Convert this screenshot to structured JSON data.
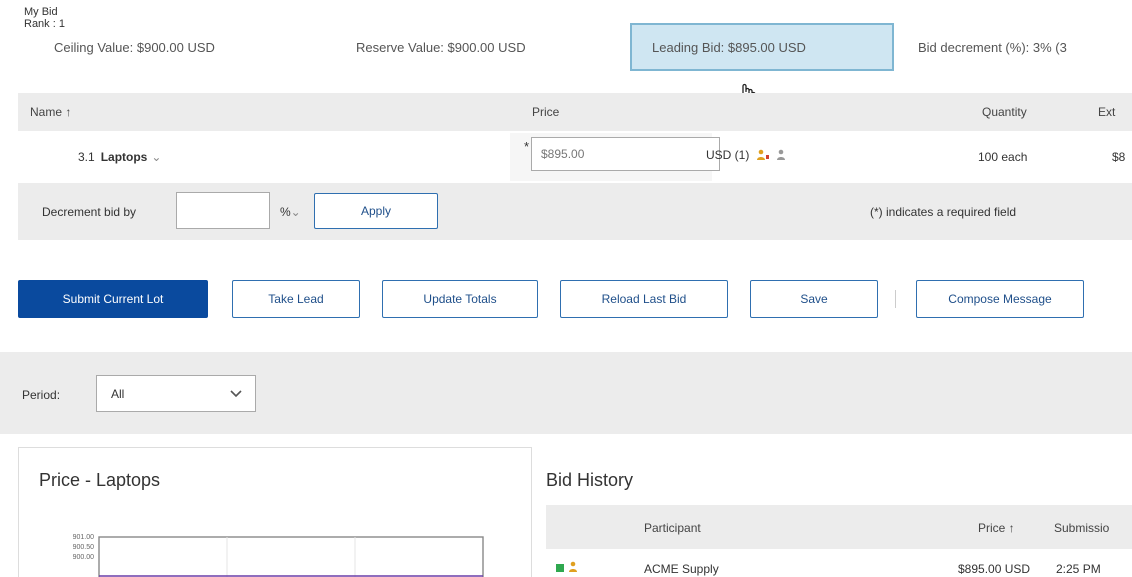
{
  "summary": {
    "rank_label": "My Bid Rank : 1",
    "ceiling": "Ceiling Value: $900.00 USD",
    "reserve": "Reserve Value: $900.00 USD",
    "leading_bid": "Leading Bid: $895.00 USD",
    "decrement": "Bid decrement (%): 3% (3"
  },
  "table": {
    "headers": {
      "name": "Name ↑",
      "price": "Price",
      "quantity": "Quantity",
      "ext": "Ext"
    },
    "row": {
      "index": "3.1",
      "name": "Laptops",
      "price_value": "$895.00",
      "currency": "USD (1)",
      "quantity": "100 each",
      "ext": "$8"
    }
  },
  "decrement_bar": {
    "label": "Decrement bid by",
    "unit": "%",
    "apply": "Apply",
    "note": "(*) indicates a required field"
  },
  "actions": {
    "submit": "Submit Current Lot",
    "take_lead": "Take Lead",
    "update_totals": "Update Totals",
    "reload": "Reload Last Bid",
    "save": "Save",
    "compose": "Compose Message"
  },
  "period": {
    "label": "Period:",
    "selected": "All"
  },
  "chart": {
    "title": "Price - Laptops",
    "ticks": [
      "901.00",
      "900.50",
      "900.00"
    ]
  },
  "bid_history": {
    "title": "Bid History",
    "headers": {
      "participant": "Participant",
      "price": "Price ↑",
      "submission": "Submissio"
    },
    "rows": [
      {
        "participant": "ACME Supply",
        "price": "$895.00 USD",
        "time": "2:25 PM"
      }
    ]
  },
  "colors": {
    "primary": "#0a4a9e",
    "leading_bg": "#cfe6f2",
    "panel_bg": "#ececec"
  }
}
